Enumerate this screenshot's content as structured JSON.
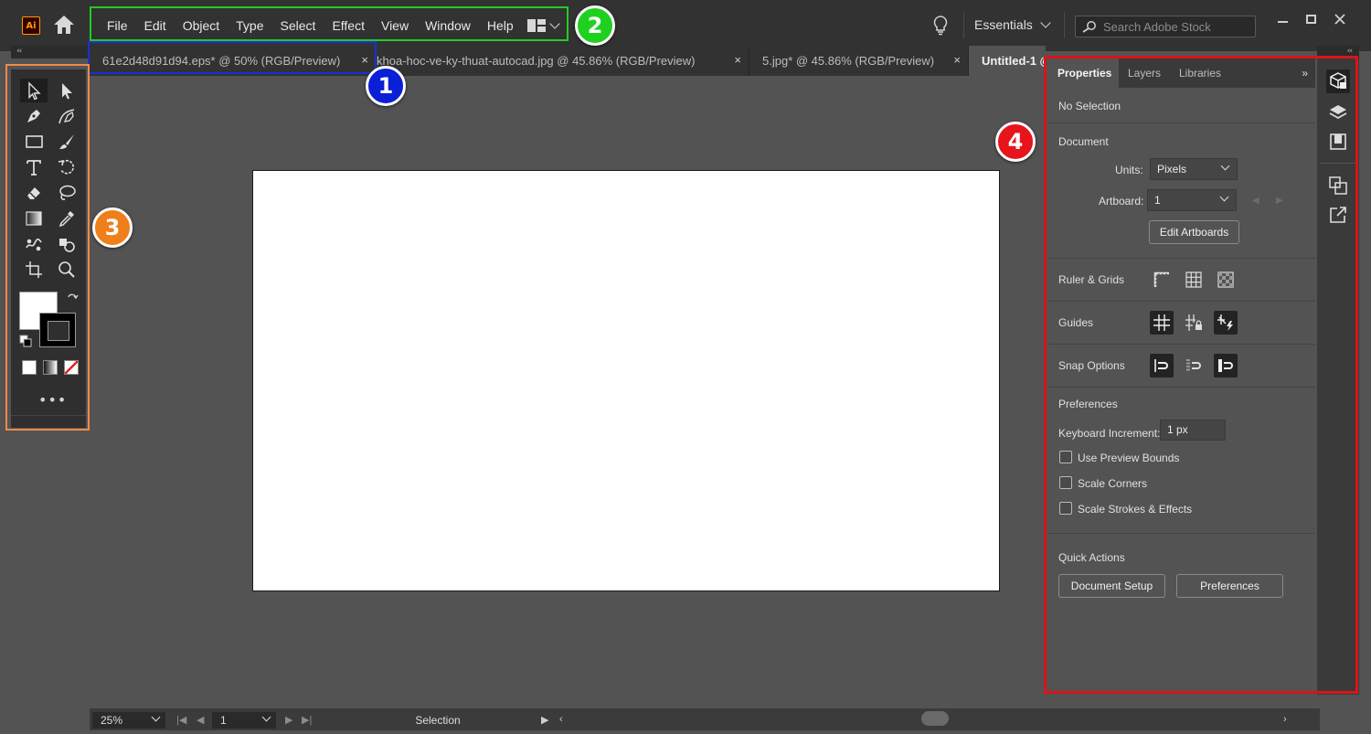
{
  "app": {
    "logo_text": "Ai"
  },
  "menu": [
    "File",
    "Edit",
    "Object",
    "Type",
    "Select",
    "Effect",
    "View",
    "Window",
    "Help"
  ],
  "workspace": {
    "label": "Essentials"
  },
  "search": {
    "placeholder": "Search Adobe Stock"
  },
  "tabs": [
    {
      "title": "61e2d48d91d94.eps* @ 50% (RGB/Preview)",
      "close": "×"
    },
    {
      "title": "khoa-hoc-ve-ky-thuat-autocad.jpg @ 45.86% (RGB/Preview)",
      "close": "×"
    },
    {
      "title": "5.jpg* @ 45.86% (RGB/Preview)",
      "close": "×"
    },
    {
      "title": "Untitled-1 @",
      "close": ""
    }
  ],
  "collapse_glyph": "‹‹",
  "panel": {
    "tabs": [
      "Properties",
      "Layers",
      "Libraries"
    ],
    "collapse": "»",
    "selection": "No Selection",
    "document_heading": "Document",
    "units_label": "Units:",
    "units_value": "Pixels",
    "artboard_label": "Artboard:",
    "artboard_value": "1",
    "edit_artboards": "Edit Artboards",
    "ruler_grids": "Ruler & Grids",
    "guides": "Guides",
    "snap_options": "Snap Options",
    "preferences_heading": "Preferences",
    "keyboard_increment_label": "Keyboard Increment:",
    "keyboard_increment_value": "1 px",
    "checkboxes": [
      "Use Preview Bounds",
      "Scale Corners",
      "Scale Strokes & Effects"
    ],
    "quick_actions": "Quick Actions",
    "document_setup": "Document Setup",
    "preferences_button": "Preferences"
  },
  "status": {
    "zoom": "25%",
    "artboard_number": "1",
    "tool_name": "Selection"
  },
  "toolbar": {
    "more": "•••"
  },
  "annotations": [
    {
      "number": "1",
      "color": "#0a1fd6"
    },
    {
      "number": "2",
      "color": "#1fd11f"
    },
    {
      "number": "3",
      "color": "#ef7f1a"
    },
    {
      "number": "4",
      "color": "#e8141b"
    }
  ],
  "colors": {
    "menubar_bg": "#323232",
    "workspace_bg": "#535353",
    "accent_orange": "#ff9a00",
    "box_blue": "#1a2fd9",
    "box_green": "#22cc22",
    "box_orange": "#ef8a4a",
    "box_red": "#d9141b"
  }
}
